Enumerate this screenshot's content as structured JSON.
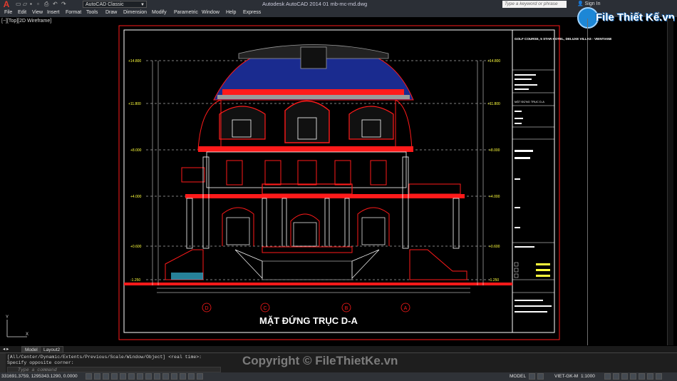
{
  "window": {
    "title": "Autodesk AutoCAD 2014    01 mb-mc-md.dwg",
    "workspace": "AutoCAD Classic",
    "search_placeholder": "Type a keyword or phrase",
    "sign_in": "Sign In"
  },
  "menu": [
    "File",
    "Edit",
    "View",
    "Insert",
    "Format",
    "Tools",
    "Draw",
    "Dimension",
    "Modify",
    "Parametric",
    "Window",
    "Help",
    "Express"
  ],
  "viewport_label": "[−][Top][2D Wireframe]",
  "logo": {
    "text": "File Thiết Kế.vn"
  },
  "drawing": {
    "sheet_title": "MẶT ĐỨNG TRỤC D-A",
    "project_title": "GOLF COURSE, 5 STAR HOTEL, DELUXE VILLAS - VIENTIANE",
    "axis_labels": [
      "D",
      "C",
      "B",
      "A"
    ],
    "elevation_left": [
      "+14.800",
      "+11.800",
      "+8.000",
      "+4.000",
      "+0.600",
      "-1.250"
    ],
    "elevation_right": [
      "+14.800",
      "+11.800",
      "+8.000",
      "+4.000",
      "+0.600",
      "-1.250"
    ],
    "title_block_sheet": "MẶT ĐỨNG TRỤC D-A",
    "colors": {
      "red": "#ff1a1a",
      "white": "#ffffff",
      "yellow": "#ffff3c",
      "blue": "#1a2b8f",
      "grey": "#9a9a9a",
      "cyan": "#40d7ff"
    }
  },
  "tabs": {
    "model": "Model",
    "layout": "Layout2"
  },
  "command": {
    "history_1": "[All/Center/Dynamic/Extents/Previous/Scale/Window/Object] <real time>:",
    "history_2": "Specify opposite corner:",
    "input_placeholder": "Type a command"
  },
  "status": {
    "coords": "331691.3759, 1295343.1290, 0.0000",
    "model": "MODEL",
    "lang": "VIET-GK-M",
    "scale": "1:1000"
  },
  "watermark": "Copyright © FileThietKe.vn"
}
